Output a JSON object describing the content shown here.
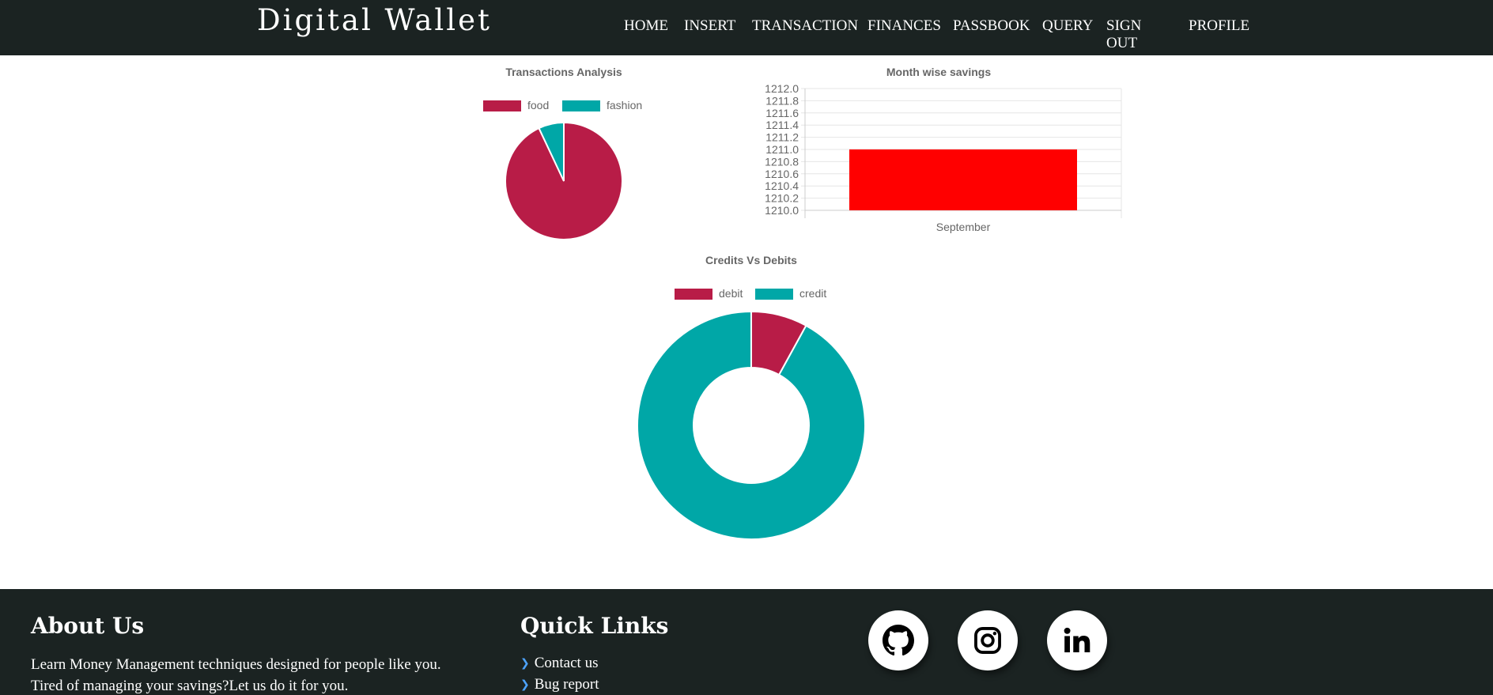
{
  "app": {
    "brand": "Digital Wallet"
  },
  "nav": [
    {
      "label": "HOME"
    },
    {
      "label": "INSERT"
    },
    {
      "label": "TRANSACTION"
    },
    {
      "label": "FINANCES"
    },
    {
      "label": "PASSBOOK"
    },
    {
      "label": "QUERY"
    },
    {
      "label": "SIGN OUT"
    },
    {
      "label": "PROFILE"
    }
  ],
  "colors": {
    "accent_red": "#b81c47",
    "accent_teal": "#00a7a7",
    "bar": "#ff0000",
    "dark": "#1b2322"
  },
  "chart_data": [
    {
      "type": "pie",
      "title": "Transactions Analysis",
      "categories": [
        "food",
        "fashion"
      ],
      "values": [
        93,
        7
      ],
      "colors": [
        "#b81c47",
        "#00a7a7"
      ],
      "legend": "top"
    },
    {
      "type": "bar",
      "title": "Month wise savings",
      "categories": [
        "September"
      ],
      "values": [
        1211.0
      ],
      "colors": [
        "#ff0000"
      ],
      "ylim": [
        1210.0,
        1212.0
      ],
      "yticks": [
        "1212.0",
        "1211.8",
        "1211.6",
        "1211.4",
        "1211.2",
        "1211.0",
        "1210.8",
        "1210.6",
        "1210.4",
        "1210.2",
        "1210.0"
      ],
      "grid": true
    },
    {
      "type": "pie",
      "title": "Credits Vs Debits",
      "categories": [
        "debit",
        "credit"
      ],
      "values": [
        8,
        92
      ],
      "colors": [
        "#b81c47",
        "#00a7a7"
      ],
      "legend": "top",
      "donut": true
    }
  ],
  "footer": {
    "about_title": "About Us",
    "about_line1": "Learn Money Management techniques designed for people like you.",
    "about_line2": "Tired of managing your savings?Let us do it for you.",
    "links_title": "Quick Links",
    "links": [
      {
        "label": "Contact us"
      },
      {
        "label": "Bug report"
      }
    ],
    "social": [
      {
        "icon": "github-icon"
      },
      {
        "icon": "instagram-icon"
      },
      {
        "icon": "linkedin-icon"
      }
    ]
  }
}
